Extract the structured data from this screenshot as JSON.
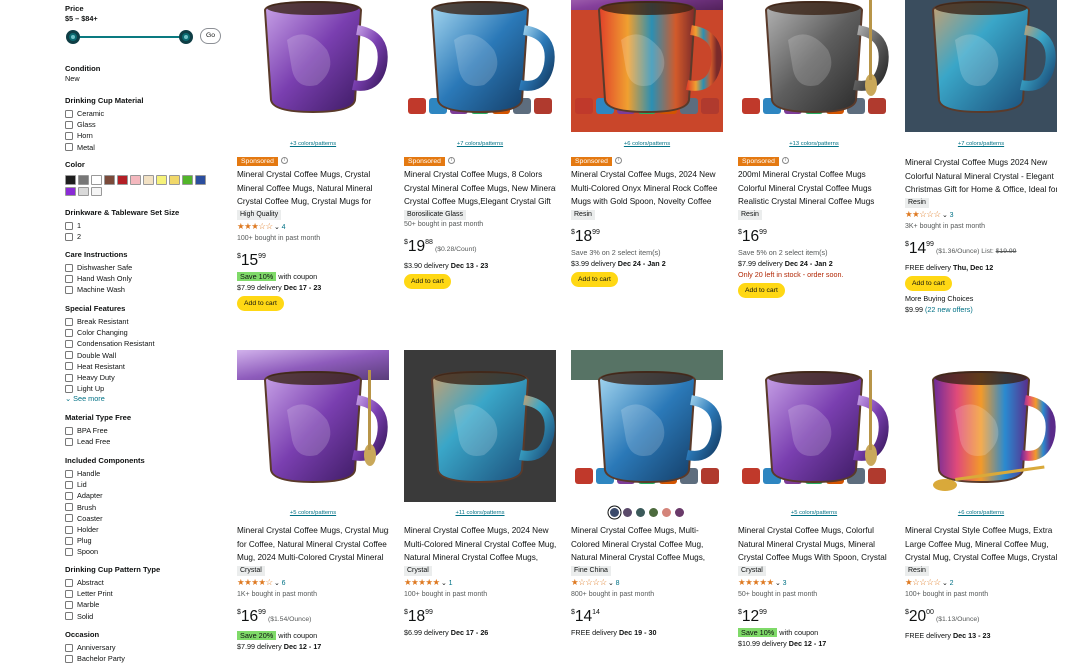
{
  "sidebar": {
    "price": {
      "title": "Price",
      "range": "$5 – $84+",
      "go": "Go"
    },
    "condition": {
      "title": "Condition",
      "value": "New"
    },
    "material": {
      "title": "Drinking Cup Material",
      "items": [
        "Ceramic",
        "Glass",
        "Horn",
        "Metal"
      ]
    },
    "color": {
      "title": "Color",
      "swatches": [
        "#1d1d1d",
        "#777777",
        "#ffffff",
        "#7a4a3a",
        "#b31f26",
        "#f4b8be",
        "#f3e2c4",
        "#f6f27a",
        "#f1d86a",
        "#52b52a",
        "#2b4e9e",
        "#8a2bd6",
        "#d9d9d9",
        "#f5f5f5"
      ]
    },
    "setsize": {
      "title": "Drinkware & Tableware Set Size",
      "items": [
        "1",
        "2"
      ]
    },
    "care": {
      "title": "Care Instructions",
      "items": [
        "Dishwasher Safe",
        "Hand Wash Only",
        "Machine Wash"
      ]
    },
    "special": {
      "title": "Special Features",
      "items": [
        "Break Resistant",
        "Color Changing",
        "Condensation Resistant",
        "Double Wall",
        "Heat Resistant",
        "Heavy Duty",
        "Light Up"
      ],
      "see_more": "See more"
    },
    "mtype": {
      "title": "Material Type Free",
      "items": [
        "BPA Free",
        "Lead Free"
      ]
    },
    "components": {
      "title": "Included Components",
      "items": [
        "Handle",
        "Lid",
        "Adapter",
        "Brush",
        "Coaster",
        "Holder",
        "Plug",
        "Spoon"
      ]
    },
    "pattern": {
      "title": "Drinking Cup Pattern Type",
      "items": [
        "Abstract",
        "Letter Print",
        "Marble",
        "Solid"
      ]
    },
    "occasion": {
      "title": "Occasion",
      "items": [
        "Anniversary",
        "Bachelor Party"
      ]
    }
  },
  "products": [
    {
      "colors": "+3 colors/patterns",
      "sponsored": "Sponsored",
      "title": "Mineral Crystal Coffee Mugs, Crystal Mineral Coffee Mugs, Natural Mineral Crystal Coffee Mug, Crystal Mugs for Coffee, Mineral Crystal Coffee Mugs...",
      "badge": "High Quality",
      "stars": "★★★☆☆",
      "reviews": "4",
      "bought": "100+ bought in past month",
      "price_whole": "15",
      "price_frac": "99",
      "coupon": "Save 10%",
      "coupon_text": "with coupon",
      "delivery": "$7.99 delivery ",
      "delivery_date": "Dec 17 - 23",
      "atc": "Add to cart",
      "img": "amethyst"
    },
    {
      "colors": "+7 colors/patterns",
      "sponsored": "Sponsored",
      "title": "Mineral Crystal Coffee Mugs, 8 Colors Crystal Mineral Coffee Mugs, New Mineral Crystal Coffee Mugs,Elegant Crystal Gift (E)",
      "badge": "Borosilicate Glass",
      "bought": "50+ bought in past month",
      "price_whole": "19",
      "price_frac": "88",
      "pp": "($0.28/Count)",
      "delivery": "$3.90 delivery ",
      "delivery_date": "Dec 13 - 23",
      "atc": "Add to cart",
      "img": "blueagate"
    },
    {
      "colors": "+6 colors/patterns",
      "sponsored": "Sponsored",
      "title": "Mineral Crystal Coffee Mugs, 2024 New Multi-Colored Onyx Mineral Rock Coffee Mugs with Gold Spoon, Novelty Coffee Mugs Colorful 3D...",
      "badge": "Resin",
      "price_whole": "18",
      "price_frac": "99",
      "save": "Save 3% on 2 select item(s)",
      "delivery": "$3.99 delivery ",
      "delivery_date": "Dec 24 - Jan 2",
      "atc": "Add to cart",
      "img": "onyx"
    },
    {
      "colors": "+13 colors/patterns",
      "sponsored": "Sponsored",
      "title": "200ml Mineral Crystal Coffee Mugs Colorful Mineral Crystal Coffee Mugs Realistic Crystal Mineral Coffee Mugs Natural Mineral Crystal Coffee Mug...",
      "badge": "Resin",
      "price_whole": "16",
      "price_frac": "99",
      "save": "Save 5% on 2 select item(s)",
      "delivery": "$7.99 delivery ",
      "delivery_date": "Dec 24 - Jan 2",
      "stock": "Only 20 left in stock - order soon.",
      "atc": "Add to cart",
      "img": "grey"
    },
    {
      "colors": "+7 colors/patterns",
      "title": "Mineral Crystal Coffee Mugs 2024 New Colorful Natural Mineral Crystal - Elegant Christmas Gift for Home & Office, Ideal for Christmas (Colorful ...",
      "badge": "Resin",
      "stars": "★★☆☆☆",
      "reviews": "3",
      "bought": "3K+ bought in past month",
      "price_whole": "14",
      "price_frac": "99",
      "pp": "($1.36/Ounce) List: ",
      "list": "$19.99",
      "delivery": "FREE delivery ",
      "delivery_date": "Thu, Dec 12",
      "atc": "Add to cart",
      "more": "More Buying Choices",
      "more_price": "$9.99 ",
      "more_offers": "(22 new offers)",
      "img": "tealmug"
    },
    {
      "colors": "+5 colors/patterns",
      "title": "Mineral Crystal Coffee Mugs, Crystal Mugs for Coffee, Natural Mineral Crystal Coffee Mug, 2024 Multi-Colored Crystal Mineral Coffee Mug...",
      "badge": "Crystal",
      "stars": "★★★★☆",
      "reviews": "6",
      "bought": "1K+ bought in past month",
      "price_whole": "16",
      "price_frac": "99",
      "pp": "($1.54/Ounce)",
      "coupon": "Save 20%",
      "coupon_text": "with coupon",
      "delivery": "$7.99 delivery ",
      "delivery_date": "Dec 12 - 17",
      "img": "amethyst2"
    },
    {
      "colors": "+11 colors/patterns",
      "title": "Mineral Crystal Coffee Mugs, 2024 New Multi-Colored Mineral Crystal Coffee Mug, Natural Mineral Crystal Coffee Mugs, Elegant Crystal Gift fo...",
      "badge": "Crystal",
      "stars": "★★★★★",
      "reviews": "1",
      "bought": "100+ bought in past month",
      "price_whole": "18",
      "price_frac": "99",
      "delivery": "$6.99 delivery ",
      "delivery_date": "Dec 17 - 26",
      "img": "steam"
    },
    {
      "title": "Mineral Crystal Coffee Mugs, Multi-Colored Mineral Crystal Coffee Mug, Natural Mineral Crystal Coffee Mugs, Colorful Onyx Crystal Mug, Christm...",
      "badge": "Fine China",
      "stars": "★☆☆☆☆",
      "reviews": "8",
      "bought": "800+ bought in past month",
      "price_whole": "14",
      "price_frac": "14",
      "delivery": "FREE delivery ",
      "delivery_date": "Dec 19 - 30",
      "dots": [
        "#3b4a6b",
        "#5a4a6a",
        "#3b5a5a",
        "#4d6b3e",
        "#d4847a",
        "#6a3a6a"
      ],
      "img": "geode"
    },
    {
      "colors": "+5 colors/patterns",
      "title": "Mineral Crystal Coffee Mugs, Colorful Natural Mineral Crystal Mugs, Mineral Crystal Coffee Mugs With Spoon, Crystal Coffee Mugs for...",
      "badge": "Crystal",
      "stars": "★★★★★",
      "reviews": "3",
      "bought": "50+ bought in past month",
      "price_whole": "12",
      "price_frac": "99",
      "coupon": "Save 10%",
      "coupon_text": "with coupon",
      "delivery": "$10.99 delivery ",
      "delivery_date": "Dec 12 - 17",
      "img": "amethyst3"
    },
    {
      "colors": "+6 colors/patterns",
      "title": "Mineral Crystal Style Coffee Mugs, Extra Large Coffee Mug, Mineral Coffee Mug, Crystal Mug, Crystal Coffee Mugs, Crystal Coffee Mug,...",
      "badge": "Resin",
      "stars": "★☆☆☆☆",
      "reviews": "2",
      "bought": "100+ bought in past month",
      "price_whole": "20",
      "price_frac": "00",
      "pp": "($1.13/Ounce)",
      "delivery": "FREE delivery ",
      "delivery_date": "Dec 13 - 23",
      "img": "rainbow"
    }
  ]
}
